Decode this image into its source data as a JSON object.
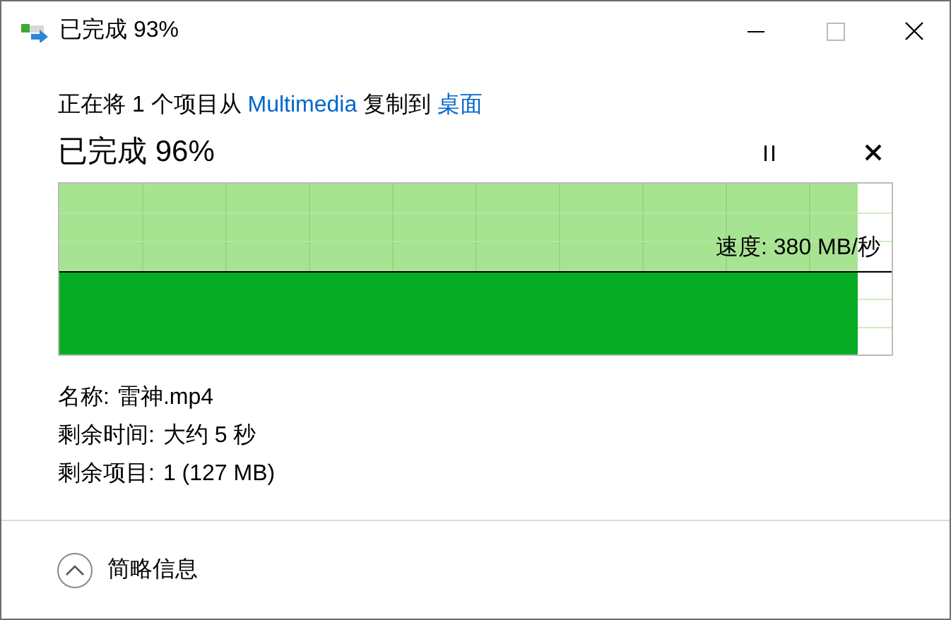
{
  "window": {
    "title": "已完成 93%"
  },
  "copy_line": {
    "prefix": "正在将 1 个项目从",
    "source": "Multimedia",
    "middle": "复制到",
    "destination": "桌面"
  },
  "progress": {
    "heading": "已完成 96%",
    "paused": false,
    "level": 0.96,
    "speed": "速度: 380 MB/秒"
  },
  "details": [
    {
      "label": "名称:",
      "value": "雷神.mp4"
    },
    {
      "label": "剩余时间:",
      "value": "大约 5 秒"
    },
    {
      "label": "剩余项目:",
      "value": "1 (127 MB)"
    }
  ],
  "footer": {
    "toggle": "简略信息",
    "expanded": true
  }
}
